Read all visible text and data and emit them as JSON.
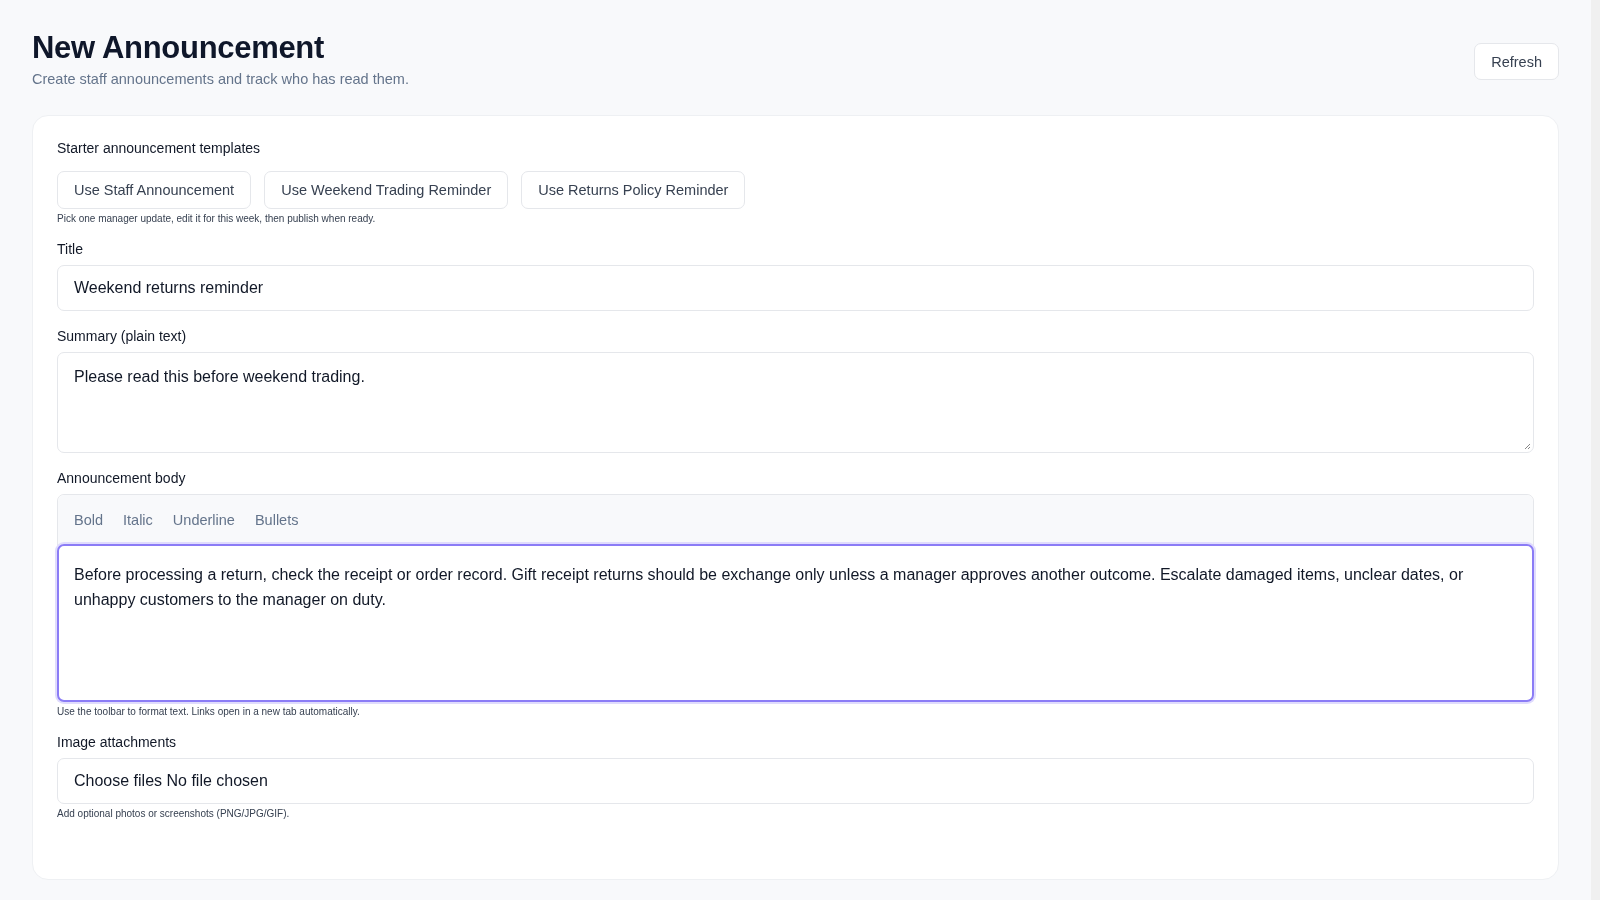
{
  "header": {
    "title": "New Announcement",
    "subtitle": "Create staff announcements and track who has read them.",
    "refresh_button": "Refresh"
  },
  "templates": {
    "label": "Starter announcement templates",
    "buttons": [
      "Use Staff Announcement",
      "Use Weekend Trading Reminder",
      "Use Returns Policy Reminder"
    ],
    "hint": "Pick one manager update, edit it for this week, then publish when ready."
  },
  "title_field": {
    "label": "Title",
    "value": "Weekend returns reminder"
  },
  "summary_field": {
    "label": "Summary (plain text)",
    "value": "Please read this before weekend trading."
  },
  "body_editor": {
    "label": "Announcement body",
    "toolbar": [
      "Bold",
      "Italic",
      "Underline",
      "Bullets"
    ],
    "value": "Before processing a return, check the receipt or order record. Gift receipt returns should be exchange only unless a manager approves another outcome. Escalate damaged items, unclear dates, or unhappy customers to the manager on duty.",
    "focused": true,
    "hint": "Use the toolbar to format text. Links open in a new tab automatically."
  },
  "attachments": {
    "label": "Image attachments",
    "value": "Choose files No file chosen",
    "hint": "Add optional photos or screenshots (PNG/JPG/GIF)."
  }
}
